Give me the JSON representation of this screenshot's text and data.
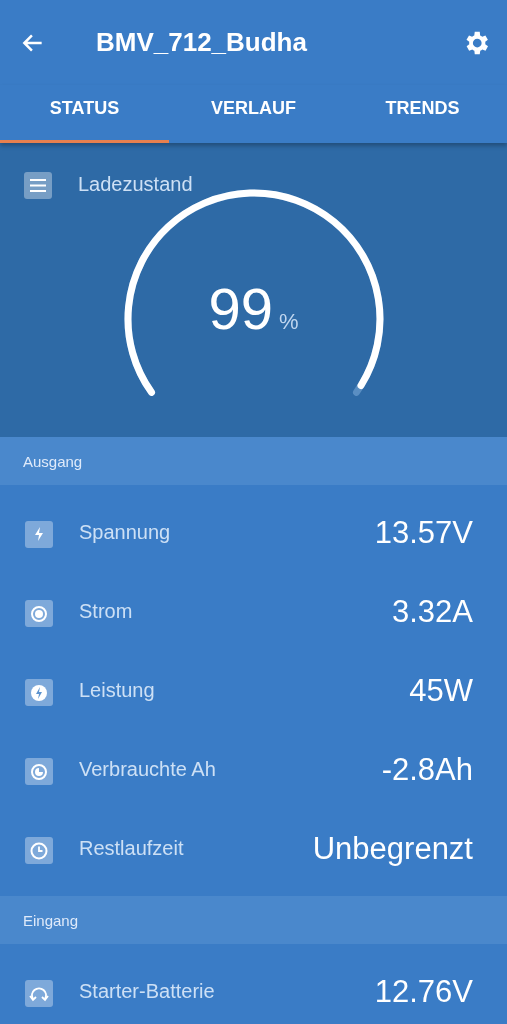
{
  "header": {
    "title": "BMV_712_Budha"
  },
  "tabs": [
    {
      "label": "STATUS",
      "selected": true
    },
    {
      "label": "VERLAUF",
      "selected": false
    },
    {
      "label": "TRENDS",
      "selected": false
    }
  ],
  "gauge": {
    "title": "Ladezustand",
    "value": "99",
    "unit": "%"
  },
  "sections": [
    {
      "title": "Ausgang",
      "rows": [
        {
          "label": "Spannung",
          "value": "13.57V"
        },
        {
          "label": "Strom",
          "value": "3.32A"
        },
        {
          "label": "Leistung",
          "value": "45W"
        },
        {
          "label": "Verbrauchte Ah",
          "value": "-2.8Ah"
        },
        {
          "label": "Restlaufzeit",
          "value": "Unbegrenzt"
        }
      ]
    },
    {
      "title": "Eingang",
      "rows": [
        {
          "label": "Starter-Batterie",
          "value": "12.76V"
        }
      ]
    }
  ]
}
